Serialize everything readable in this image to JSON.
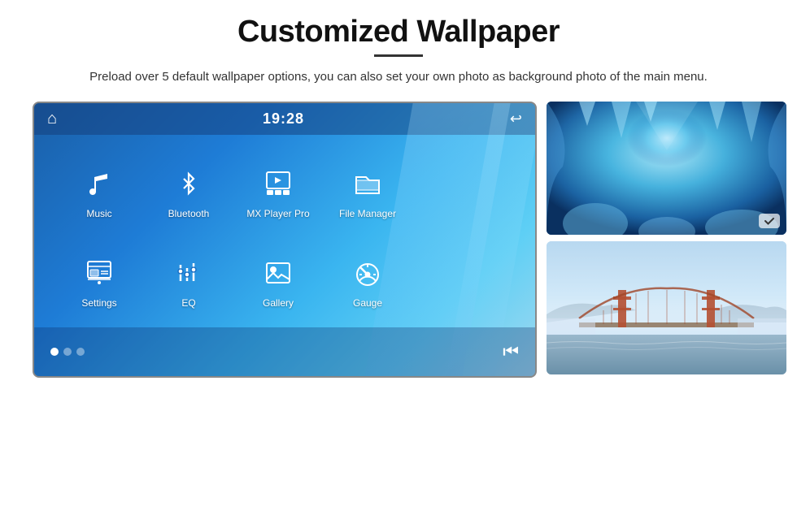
{
  "header": {
    "title": "Customized Wallpaper",
    "subtitle": "Preload over 5 default wallpaper options, you can also set your own photo as background photo of the main menu."
  },
  "screen": {
    "time": "19:28",
    "apps_row1": [
      {
        "id": "music",
        "label": "Music",
        "icon": "♪"
      },
      {
        "id": "bluetooth",
        "label": "Bluetooth",
        "icon": "📶"
      },
      {
        "id": "mxplayer",
        "label": "MX Player Pro",
        "icon": "▶"
      },
      {
        "id": "filemanager",
        "label": "File Manager",
        "icon": "📁"
      }
    ],
    "apps_row2": [
      {
        "id": "settings",
        "label": "Settings",
        "icon": "⚙"
      },
      {
        "id": "eq",
        "label": "EQ",
        "icon": "🎛"
      },
      {
        "id": "gallery",
        "label": "Gallery",
        "icon": "🖼"
      },
      {
        "id": "gauge",
        "label": "Gauge",
        "icon": "⏱"
      }
    ],
    "dots": [
      "active",
      "inactive",
      "inactive"
    ]
  },
  "thumbnails": [
    {
      "id": "ice-cave",
      "alt": "Ice cave wallpaper"
    },
    {
      "id": "golden-gate",
      "alt": "Golden Gate Bridge wallpaper"
    }
  ]
}
